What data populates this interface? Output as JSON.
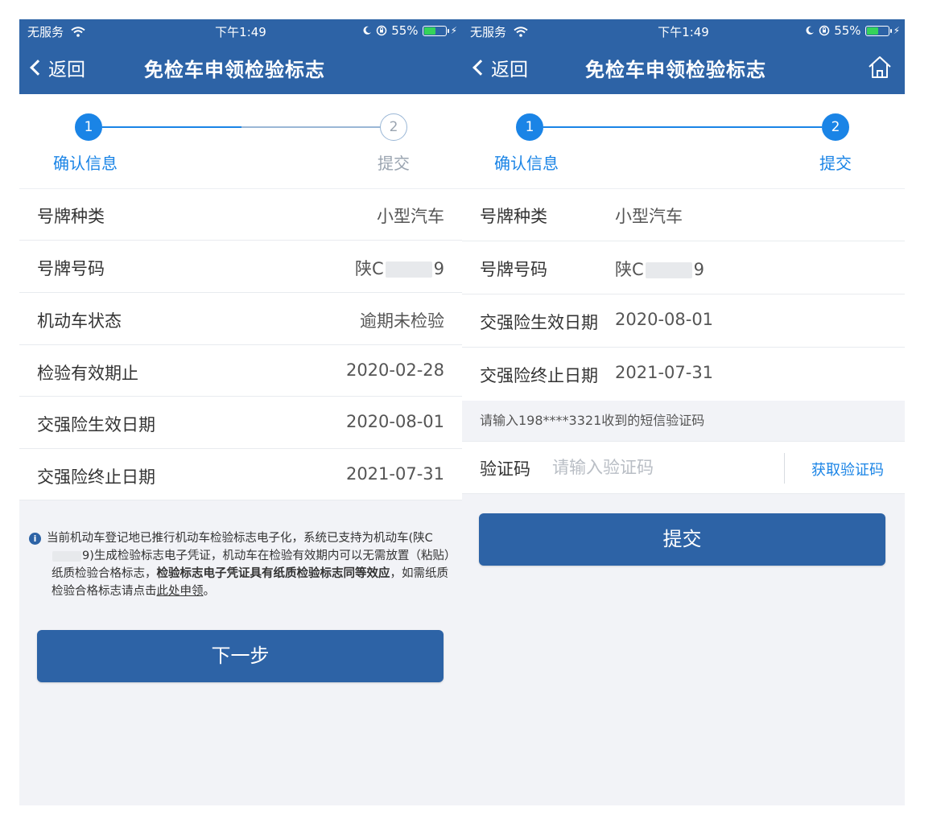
{
  "statusbar": {
    "carrier": "无服务",
    "time": "下午1:49",
    "battery_text": "55%",
    "battery_level": 0.55
  },
  "left": {
    "nav": {
      "back_label": "返回",
      "title": "免检车申领检验标志"
    },
    "steps": [
      {
        "number": "1",
        "label": "确认信息"
      },
      {
        "number": "2",
        "label": "提交"
      }
    ],
    "rows": [
      {
        "label": "号牌种类",
        "value": "小型汽车"
      },
      {
        "label": "号牌号码",
        "value_prefix": "陕C",
        "value_suffix": "9"
      },
      {
        "label": "机动车状态",
        "value": "逾期未检验"
      },
      {
        "label": "检验有效期止",
        "value": "2020-02-28"
      },
      {
        "label": "交强险生效日期",
        "value": "2020-08-01"
      },
      {
        "label": "交强险终止日期",
        "value": "2021-07-31"
      }
    ],
    "notice": {
      "part1": "当前机动车登记地已推行机动车检验标志电子化，系统已支持为机动车(陕C",
      "part2": "9)生成检验标志电子凭证，机动车在检验有效期内可以无需放置（粘贴）纸质检验合格标志，",
      "bold": "检验标志电子凭证具有纸质检验标志同等效应",
      "part3": "，如需纸质检验合格标志请点击",
      "link": "此处申领",
      "end": "。"
    },
    "next_button": "下一步"
  },
  "right": {
    "nav": {
      "back_label": "返回",
      "title": "免检车申领检验标志"
    },
    "steps": [
      {
        "number": "1",
        "label": "确认信息"
      },
      {
        "number": "2",
        "label": "提交"
      }
    ],
    "rows": [
      {
        "label": "号牌种类",
        "value": "小型汽车"
      },
      {
        "label": "号牌号码",
        "value_prefix": "陕C",
        "value_suffix": "9"
      },
      {
        "label": "交强险生效日期",
        "value": "2020-08-01"
      },
      {
        "label": "交强险终止日期",
        "value": "2021-07-31"
      }
    ],
    "sms_hint": "请输入198****3321收到的短信验证码",
    "code": {
      "label": "验证码",
      "placeholder": "请输入验证码",
      "value": "",
      "get_code": "获取验证码"
    },
    "submit_button": "提交"
  },
  "colors": {
    "brand_blue": "#2d63a6",
    "active_blue": "#1a84e6",
    "inactive_gray": "#9aa4b0",
    "battery_green": "#35d35a"
  }
}
